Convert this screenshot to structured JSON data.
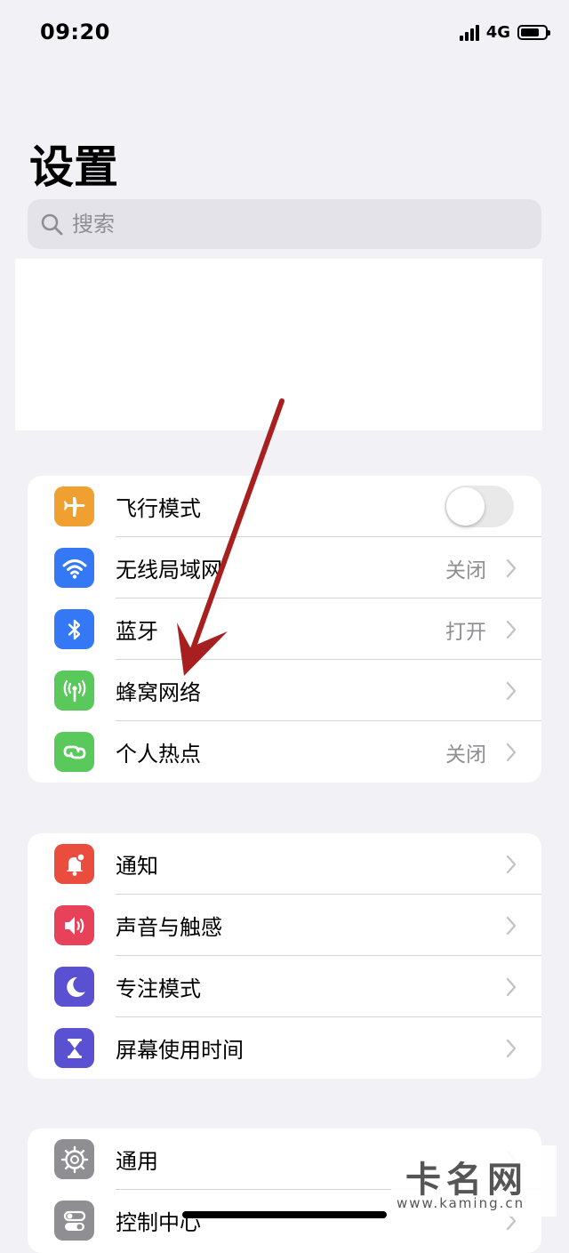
{
  "status_bar": {
    "time": "09:20",
    "network": "4G"
  },
  "header": {
    "title": "设置"
  },
  "search": {
    "placeholder": "搜索"
  },
  "groups": [
    {
      "items": [
        {
          "label": "飞行模式",
          "icon": "airplane-icon",
          "color": "#f0a030",
          "toggle": false
        },
        {
          "label": "无线局域网",
          "value": "关闭",
          "icon": "wifi-icon",
          "color": "#3478f6"
        },
        {
          "label": "蓝牙",
          "value": "打开",
          "icon": "bluetooth-icon",
          "color": "#3478f6"
        },
        {
          "label": "蜂窝网络",
          "value": "",
          "icon": "cellular-icon",
          "color": "#5ac95b"
        },
        {
          "label": "个人热点",
          "value": "关闭",
          "icon": "hotspot-icon",
          "color": "#5ac95b"
        }
      ]
    },
    {
      "items": [
        {
          "label": "通知",
          "icon": "notification-icon",
          "color": "#ea4d3d"
        },
        {
          "label": "声音与触感",
          "icon": "sound-icon",
          "color": "#e8425a"
        },
        {
          "label": "专注模式",
          "icon": "moon-icon",
          "color": "#5a50d2"
        },
        {
          "label": "屏幕使用时间",
          "icon": "hourglass-icon",
          "color": "#5a50d2"
        }
      ]
    },
    {
      "items": [
        {
          "label": "通用",
          "icon": "gear-icon",
          "color": "#8e8e93"
        },
        {
          "label": "控制中心",
          "icon": "switches-icon",
          "color": "#8e8e93"
        }
      ]
    }
  ],
  "watermark": {
    "title": "卡名网",
    "url": "www.kaming.cn"
  }
}
